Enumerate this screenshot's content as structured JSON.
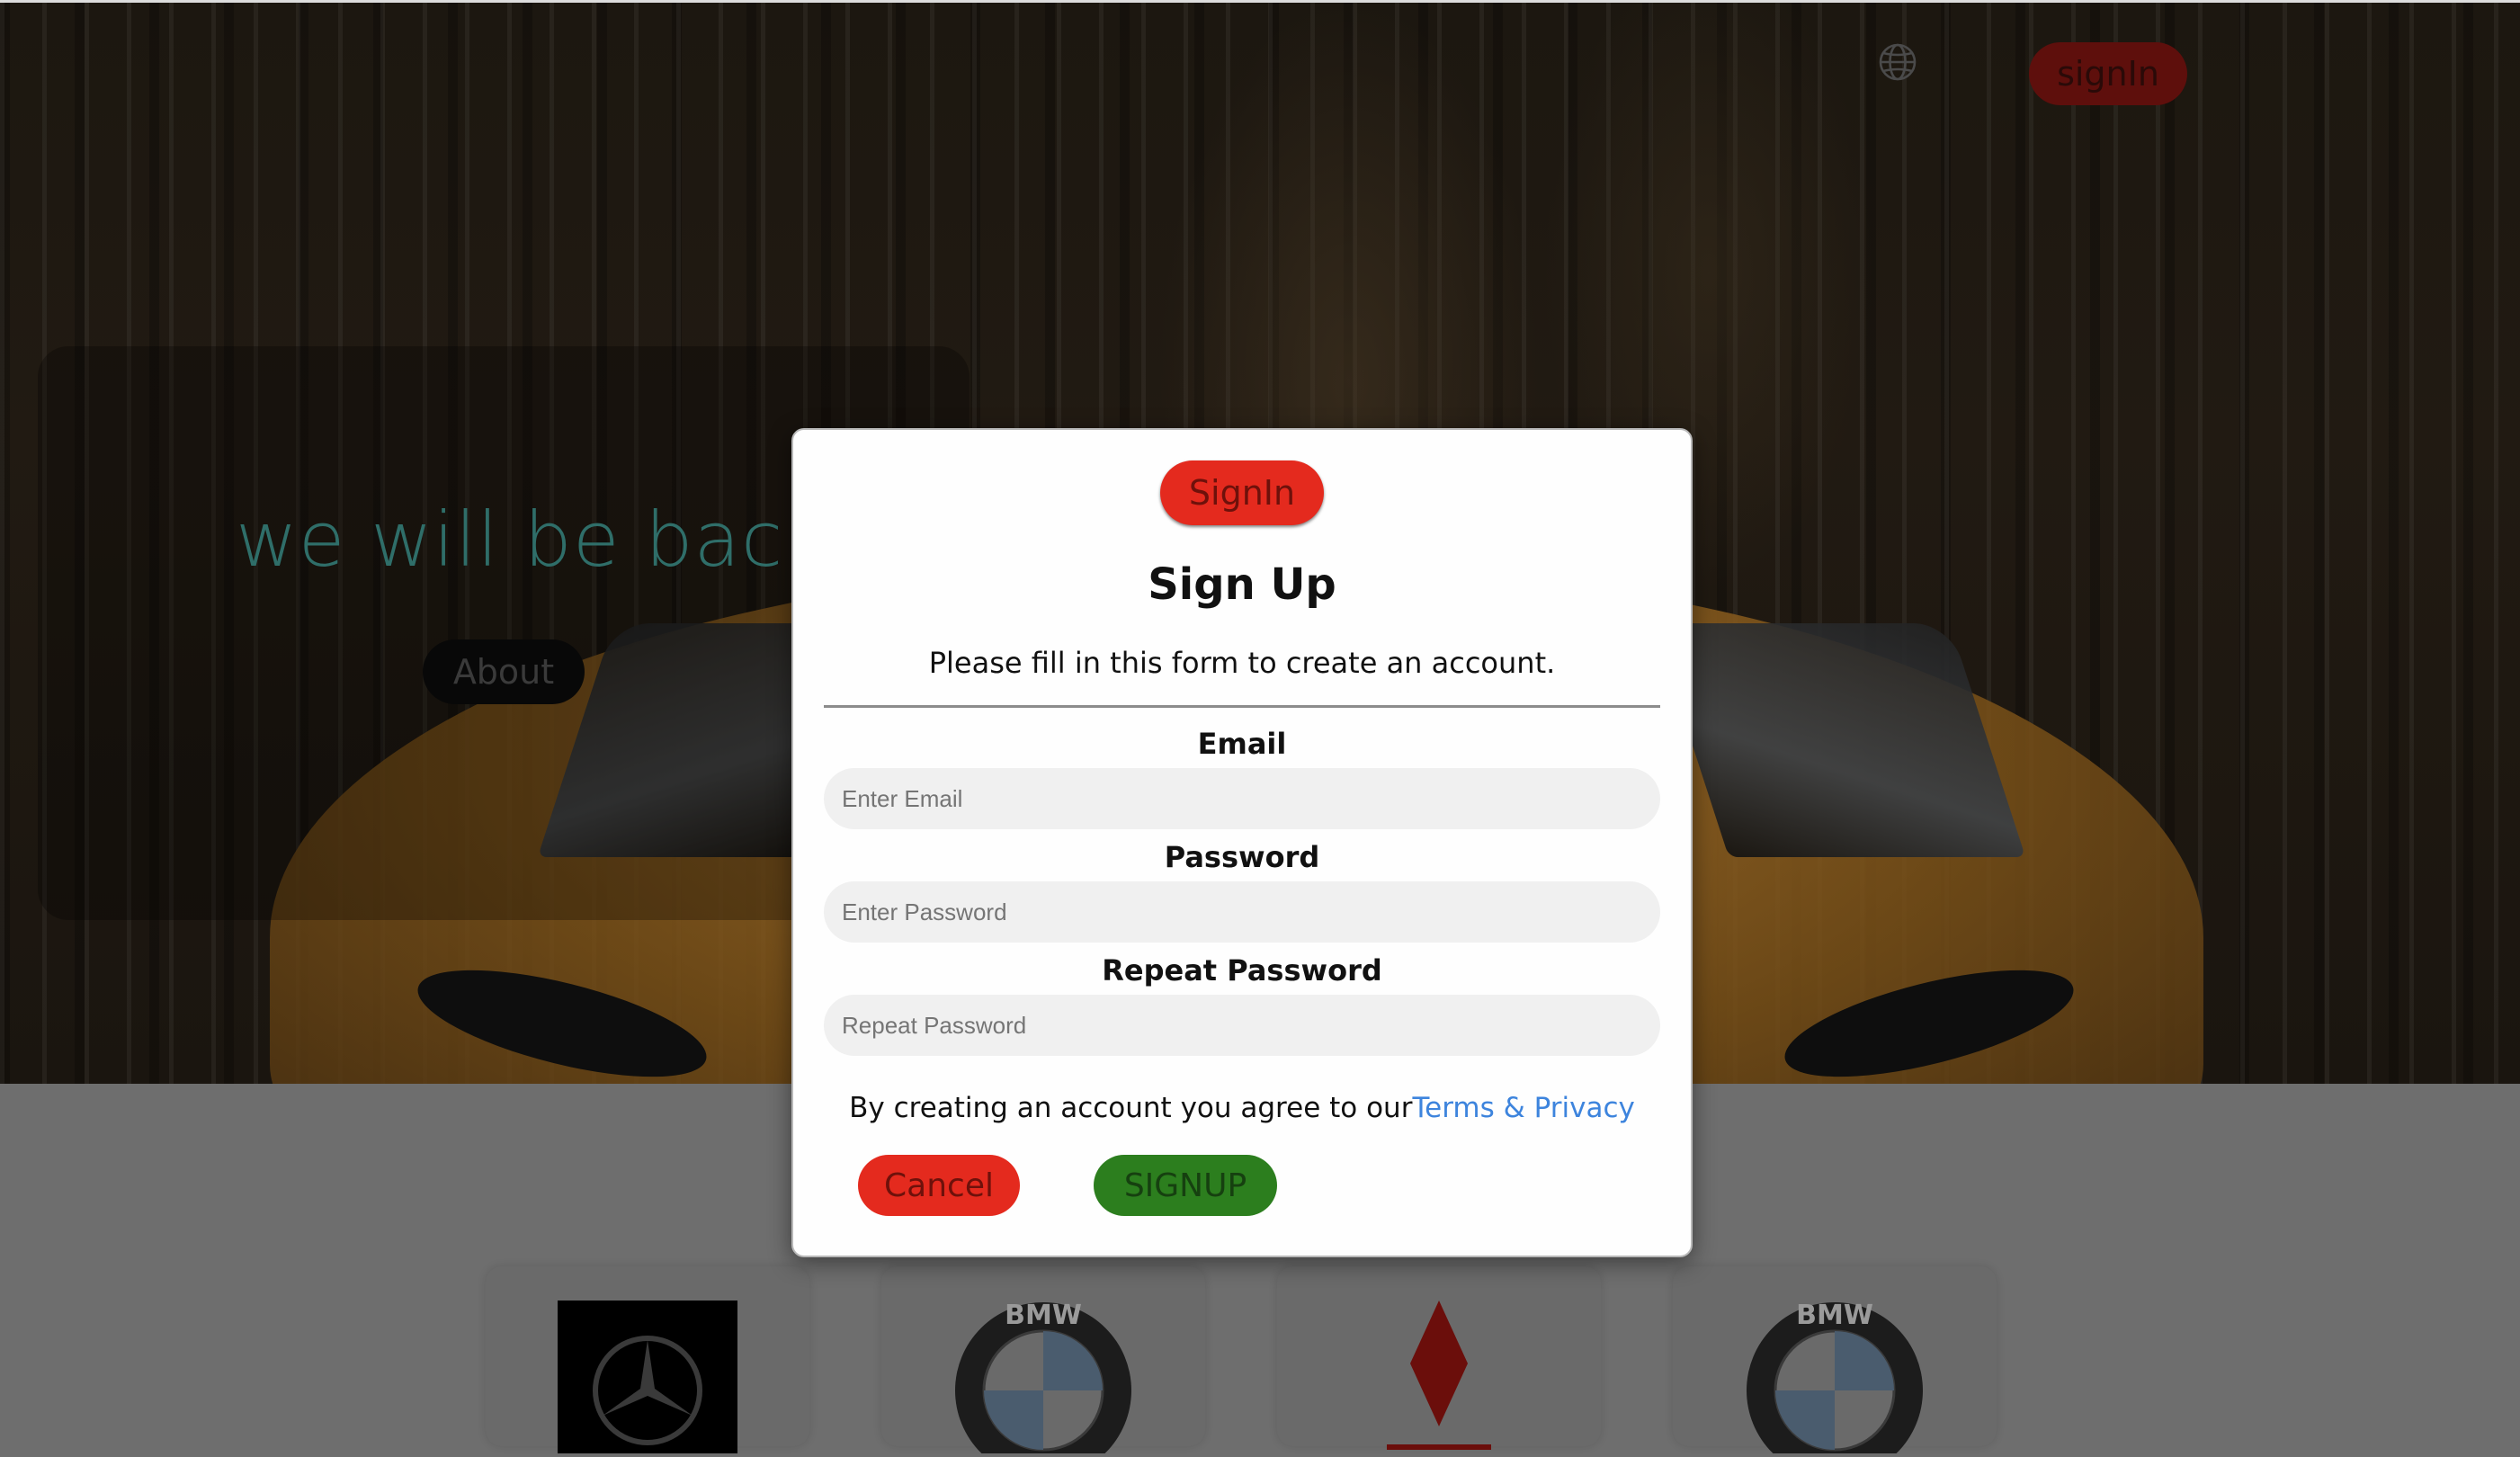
{
  "hero": {
    "title": "we will be back",
    "about_label": "About"
  },
  "header": {
    "language_icon": "globe-icon",
    "signin_label": "signIn"
  },
  "modal": {
    "signin_label": "SignIn",
    "title": "Sign Up",
    "subtitle": "Please fill in this form to create an account.",
    "fields": [
      {
        "label": "Email",
        "value": "",
        "placeholder": "Enter Email"
      },
      {
        "label": "Password",
        "value": "",
        "placeholder": "Enter Password"
      },
      {
        "label": "Repeat Password",
        "value": "",
        "placeholder": "Repeat Password"
      }
    ],
    "terms_text": "By creating an account you agree to our",
    "terms_link": "Terms & Privacy",
    "cancel_label": "Cancel",
    "signup_label": "SIGNUP"
  },
  "brands": [
    {
      "name_icon": "mercedes-logo-icon"
    },
    {
      "name_icon": "bmw-logo-icon",
      "letters": "BMW"
    },
    {
      "name_icon": "mitsubishi-logo-icon"
    },
    {
      "name_icon": "bmw-logo-icon",
      "letters": "BMW"
    }
  ],
  "colors": {
    "accent_red": "#e42a1e",
    "signup_green": "#2c7e1e",
    "link_blue": "#3d84dd",
    "hero_title_teal": "#2f6e69"
  }
}
